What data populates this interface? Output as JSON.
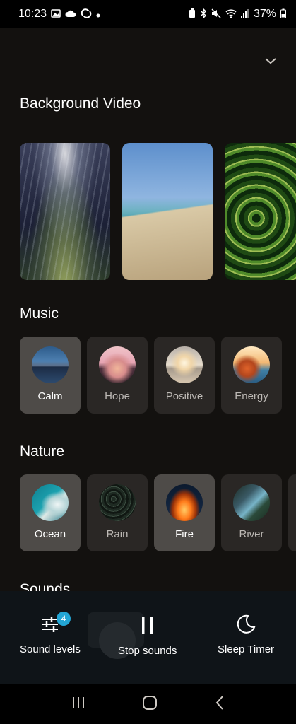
{
  "status_bar": {
    "time": "10:23",
    "battery": "37%"
  },
  "sections": {
    "background_video": "Background Video",
    "music": "Music",
    "nature": "Nature",
    "sounds": "Sounds"
  },
  "music": {
    "items": [
      {
        "label": "Calm",
        "active": true
      },
      {
        "label": "Hope",
        "active": false
      },
      {
        "label": "Positive",
        "active": false
      },
      {
        "label": "Energy",
        "active": false
      }
    ]
  },
  "nature": {
    "items": [
      {
        "label": "Ocean",
        "active": true
      },
      {
        "label": "Rain",
        "active": false
      },
      {
        "label": "Fire",
        "active": true
      },
      {
        "label": "River",
        "active": false
      }
    ]
  },
  "controls": {
    "sound_levels": "Sound levels",
    "sound_levels_badge": "4",
    "stop_sounds": "Stop sounds",
    "sleep_timer": "Sleep Timer"
  },
  "colors": {
    "accent_badge": "#23a6d5",
    "active_tile": "#4e4b48",
    "tile": "#2a2725"
  }
}
